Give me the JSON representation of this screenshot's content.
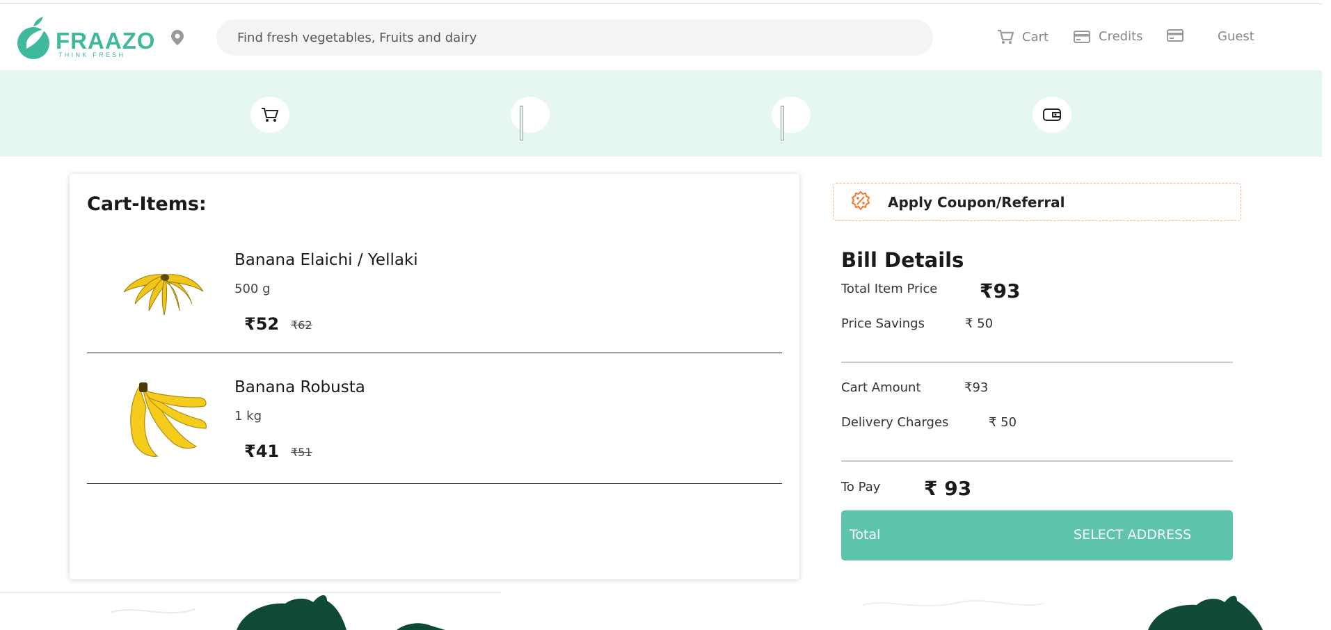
{
  "brand": {
    "name": "FRAAZO",
    "tagline": "THINK FRESH"
  },
  "search": {
    "placeholder": "Find fresh vegetables, Fruits and dairy"
  },
  "nav": {
    "cart": "Cart",
    "credits": "Credits",
    "user": "Guest"
  },
  "steps": [
    "cart-icon",
    "step-2",
    "step-3",
    "wallet-icon"
  ],
  "cart": {
    "title": "Cart-Items:",
    "items": [
      {
        "name": "Banana Elaichi / Yellaki",
        "qty": "500 g",
        "price": "₹52",
        "mrp": "₹62"
      },
      {
        "name": "Banana Robusta",
        "qty": "1 kg",
        "price": "₹41",
        "mrp": "₹51"
      }
    ]
  },
  "coupon": {
    "label": "Apply Coupon/Referral"
  },
  "bill": {
    "title": "Bill Details",
    "total_item_price_label": "Total Item Price",
    "total_item_price": "₹93",
    "price_savings_label": "Price Savings",
    "price_savings": "₹ 50",
    "cart_amount_label": "Cart Amount",
    "cart_amount": "₹93",
    "delivery_label": "Delivery Charges",
    "delivery": "₹ 50",
    "to_pay_label": "To Pay",
    "to_pay": "₹ 93"
  },
  "checkout": {
    "left": "Total",
    "button": "SELECT ADDRESS"
  },
  "colors": {
    "brand": "#3fb89c",
    "band": "#e6f7f1",
    "button": "#5ec4ab",
    "coupon_border": "#f5b58a",
    "dark_green": "#0e4a35"
  }
}
